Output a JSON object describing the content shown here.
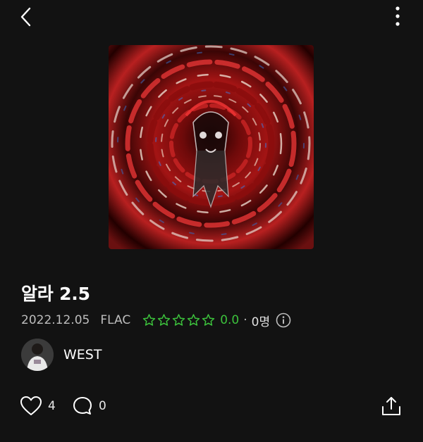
{
  "nav": {
    "back_icon": "chevron-left-icon",
    "more_icon": "more-vertical-icon"
  },
  "track": {
    "title": "알라 2.5",
    "date": "2022.12.05",
    "format": "FLAC",
    "rating_value": "0.0",
    "rating_count": "0명",
    "rating_fraction": 0,
    "separator": "·"
  },
  "artist": {
    "name": "WEST"
  },
  "actions": {
    "likes": "4",
    "comments": "0"
  },
  "colors": {
    "background": "#121212",
    "rating_green": "#3cc23c",
    "meta_gray": "#bdbdbd"
  }
}
